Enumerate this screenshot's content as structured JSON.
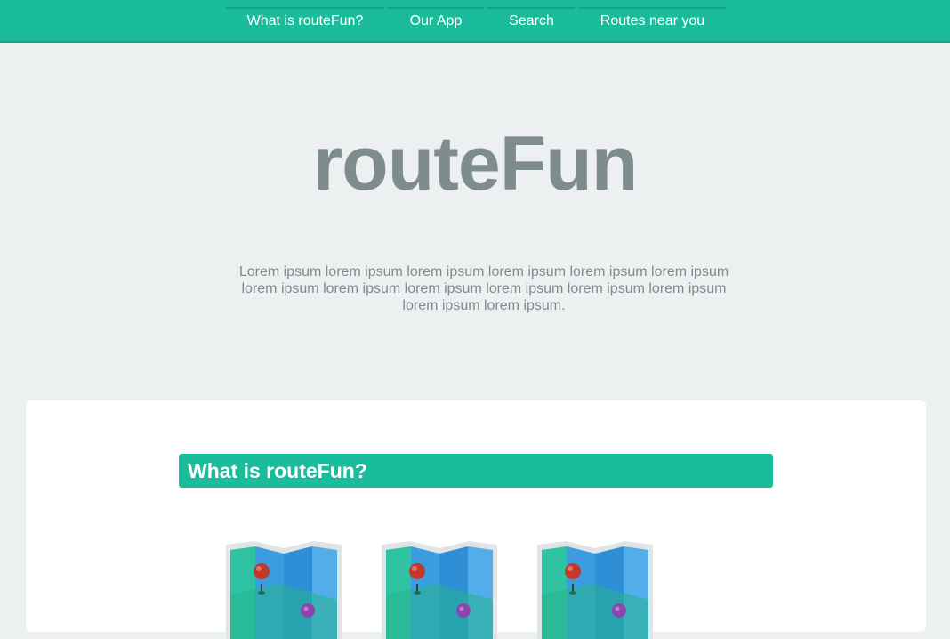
{
  "nav": {
    "items": [
      {
        "label": "What is routeFun?"
      },
      {
        "label": "Our App"
      },
      {
        "label": "Search"
      },
      {
        "label": "Routes near you"
      }
    ]
  },
  "hero": {
    "title": "routeFun",
    "text": "Lorem ipsum lorem ipsum lorem ipsum lorem ipsum lorem ipsum lorem ipsum lorem ipsum lorem ipsum lorem ipsum lorem ipsum lorem ipsum lorem ipsum lorem ipsum lorem ipsum."
  },
  "section": {
    "heading": "What is routeFun?",
    "icons": [
      "map-icon",
      "map-icon",
      "map-icon"
    ]
  },
  "colors": {
    "accent": "#1abc9c",
    "accent_dark": "#16a085",
    "background": "#ecf0f1",
    "muted_text": "#7f8c8d"
  }
}
